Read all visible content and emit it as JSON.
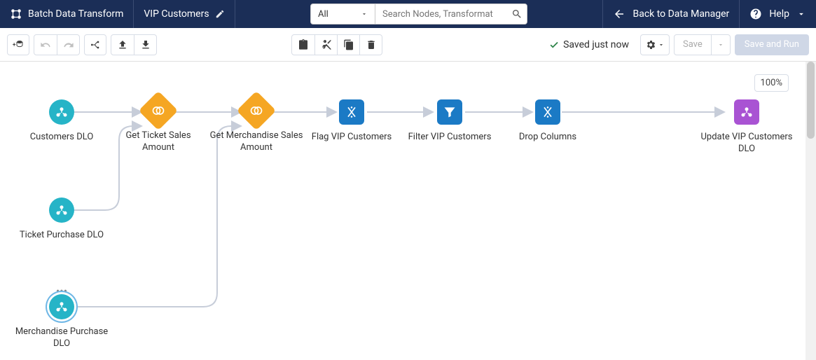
{
  "header": {
    "app_label": "Batch Data Transform",
    "transform_name": "VIP Customers",
    "search_filter": "All",
    "search_placeholder": "Search Nodes, Transformat",
    "back_label": "Back to Data Manager",
    "help_label": "Help"
  },
  "toolbar": {
    "status_text": "Saved just now",
    "save_label": "Save",
    "save_and_run_label": "Save and Run"
  },
  "canvas": {
    "zoom_level": "100%",
    "nodes": {
      "customers": {
        "label": "Customers DLO",
        "type": "input"
      },
      "ticket_purchase": {
        "label": "Ticket Purchase DLO",
        "type": "input"
      },
      "merch_purchase": {
        "label": "Merchandise Purchase DLO",
        "type": "input",
        "selected": true
      },
      "get_ticket": {
        "label": "Get Ticket Sales Amount",
        "type": "join"
      },
      "get_merch": {
        "label": "Get Merchandise Sales Amount",
        "type": "join"
      },
      "flag": {
        "label": "Flag VIP Customers",
        "type": "step"
      },
      "filter": {
        "label": "Filter VIP Customers",
        "type": "step"
      },
      "drop": {
        "label": "Drop Columns",
        "type": "step"
      },
      "update_output": {
        "label": "Update VIP Customers DLO",
        "type": "output"
      }
    }
  }
}
